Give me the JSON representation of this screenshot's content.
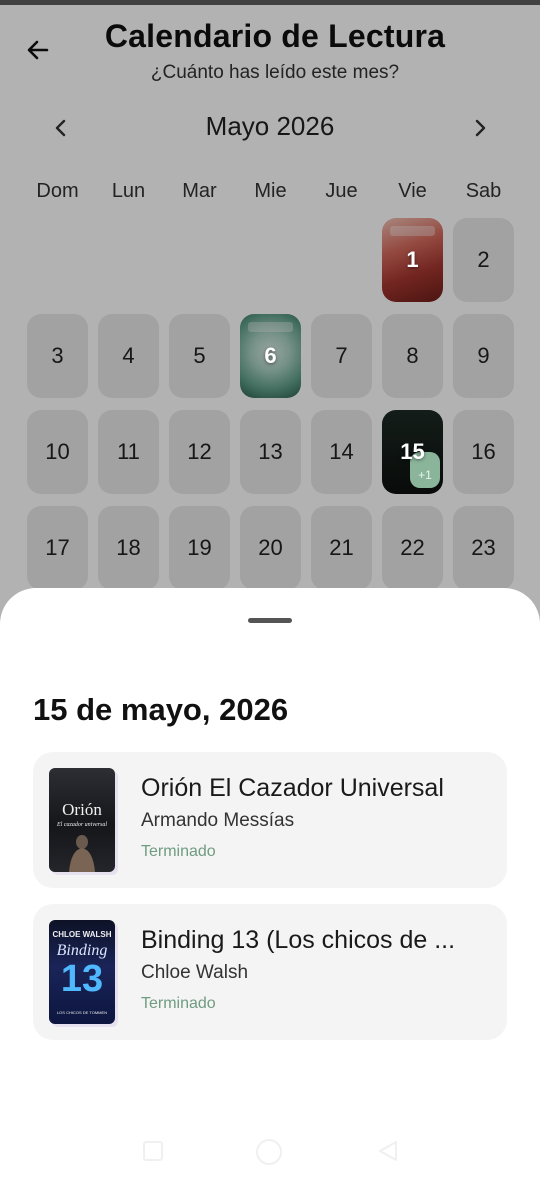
{
  "header": {
    "title": "Calendario de Lectura",
    "subtitle": "¿Cuánto has leído este mes?",
    "back_icon": "arrow-left-icon"
  },
  "calendar": {
    "month_label": "Mayo 2026",
    "prev_icon": "chevron-left-icon",
    "next_icon": "chevron-right-icon",
    "weekdays": [
      "Dom",
      "Lun",
      "Mar",
      "Mie",
      "Jue",
      "Vie",
      "Sab"
    ],
    "week1": [
      "",
      "",
      "",
      "",
      "",
      "1",
      "2"
    ],
    "week2": [
      "3",
      "4",
      "5",
      "6",
      "7",
      "8",
      "9"
    ],
    "week3": [
      "10",
      "11",
      "12",
      "13",
      "14",
      "15",
      "16"
    ],
    "week4": [
      "17",
      "18",
      "19",
      "20",
      "21",
      "22",
      "23"
    ],
    "day15_badge": "+1"
  },
  "sheet": {
    "date_title": "15 de mayo, 2026",
    "books": [
      {
        "title": "Orión El Cazador Universal",
        "author": "Armando Messías",
        "status": "Terminado",
        "cover_title": "Orión",
        "cover_subtitle": "El cazador universal"
      },
      {
        "title": "Binding 13 (Los chicos de ...",
        "author": "Chloe Walsh",
        "status": "Terminado",
        "cover_author": "CHLOE WALSH",
        "cover_title": "Binding",
        "cover_number": "13",
        "cover_footer": "LOS CHICOS DE TOMMEN"
      }
    ]
  },
  "colors": {
    "accent_green": "#6f9c80",
    "badge_green": "#8ab59b",
    "cell_bg": "#e9e9e9"
  }
}
